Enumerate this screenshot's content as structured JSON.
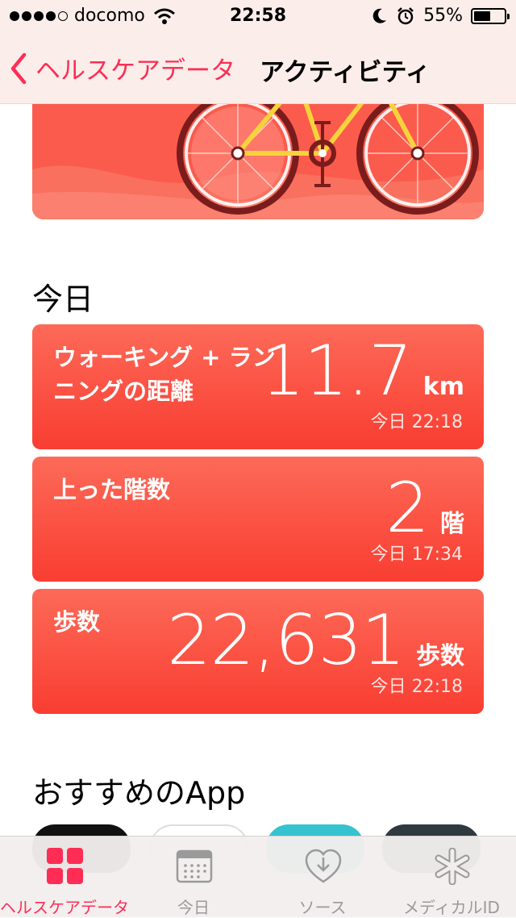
{
  "status": {
    "carrier": "docomo",
    "time": "22:58",
    "battery": "55%",
    "battery_level": 0.55
  },
  "nav": {
    "back_label": "ヘルスケアデータ",
    "title": "アクティビティ"
  },
  "today_section": {
    "title": "今日"
  },
  "cards": [
    {
      "label": "ウォーキング + ランニングの距離",
      "value": "11.7",
      "unit": "km",
      "timestamp": "今日 22:18"
    },
    {
      "label": "上った階数",
      "value": "2",
      "unit": "階",
      "timestamp": "今日 17:34"
    },
    {
      "label": "歩数",
      "value": "22,631",
      "unit": "歩数",
      "timestamp": "今日 22:18"
    }
  ],
  "recommended_section": {
    "title": "おすすめのApp"
  },
  "tabbar": {
    "items": [
      {
        "label": "ヘルスケアデータ",
        "icon": "grid-icon",
        "active": true
      },
      {
        "label": "今日",
        "icon": "calendar-icon",
        "active": false
      },
      {
        "label": "ソース",
        "icon": "heart-download-icon",
        "active": false
      },
      {
        "label": "メディカルID",
        "icon": "asterisk-icon",
        "active": false
      }
    ]
  },
  "colors": {
    "accent": "#ff2d55",
    "card_top": "#fd6a58",
    "card_bottom": "#f93d32"
  }
}
